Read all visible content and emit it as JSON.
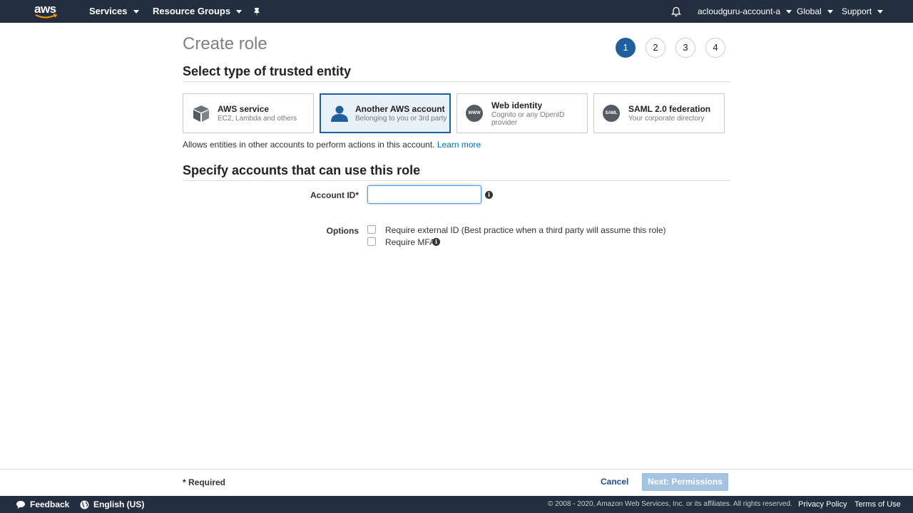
{
  "topnav": {
    "logo_text": "aws",
    "services": "Services",
    "resource_groups": "Resource Groups",
    "account": "acloudguru-account-a",
    "region": "Global",
    "support": "Support"
  },
  "page": {
    "title": "Create role",
    "steps": [
      "1",
      "2",
      "3",
      "4"
    ],
    "active_step": 1
  },
  "trusted_entity": {
    "heading": "Select type of trusted entity",
    "cards": [
      {
        "title": "AWS service",
        "subtitle": "EC2, Lambda and others",
        "icon": "box-icon"
      },
      {
        "title": "Another AWS account",
        "subtitle": "Belonging to you or 3rd party",
        "icon": "user-icon"
      },
      {
        "title": "Web identity",
        "subtitle": "Cognito or any OpenID provider",
        "icon": "www-icon",
        "icon_text": "WWW"
      },
      {
        "title": "SAML 2.0 federation",
        "subtitle": "Your corporate directory",
        "icon": "saml-icon",
        "icon_text": "SAML"
      }
    ],
    "selected_index": 1,
    "description": "Allows entities in other accounts to perform actions in this account.",
    "learn_more": "Learn more"
  },
  "accounts": {
    "heading": "Specify accounts that can use this role",
    "account_id_label": "Account ID*",
    "account_id_value": "",
    "options_label": "Options",
    "option_external_id": "Require external ID (Best practice when a third party will assume this role)",
    "option_mfa": "Require MFA"
  },
  "footer": {
    "required_note": "* Required",
    "cancel": "Cancel",
    "next": "Next: Permissions"
  },
  "bottombar": {
    "feedback": "Feedback",
    "language": "English (US)",
    "copyright": "© 2008 - 2020, Amazon Web Services, Inc. or its affiliates. All rights reserved.",
    "privacy": "Privacy Policy",
    "terms": "Terms of Use"
  },
  "colors": {
    "nav_bg": "#232f3e",
    "accent": "#1f5f9e",
    "link": "#0073bb",
    "disabled_button": "#a5c4e0"
  }
}
